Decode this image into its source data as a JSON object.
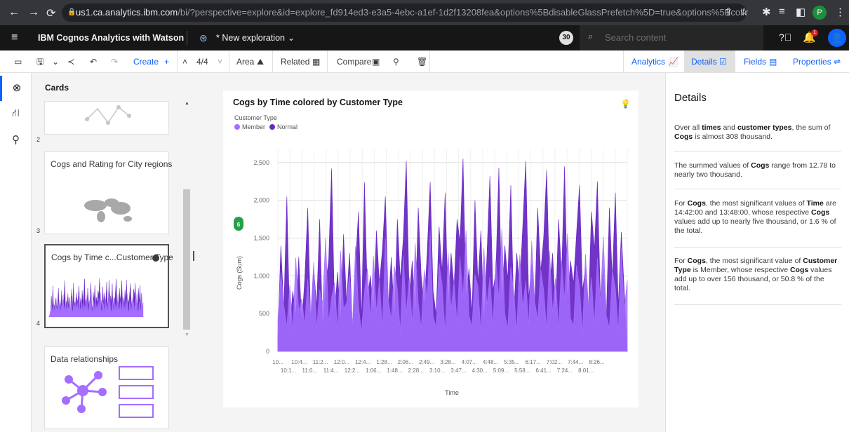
{
  "browser": {
    "url_host": "us1.ca.analytics.ibm.com",
    "url_rest": "/bi/?perspective=explore&id=explore_fd914ed3-e3a5-4ebc-a1ef-1d2f13208fea&options%5BdisableGlassPrefetch%5D=true&options%5Bcollections%5D%5Bcan...",
    "profile_initial": "P"
  },
  "app": {
    "title": "IBM Cognos Analytics with Watson",
    "exploration": "* New exploration",
    "badge_count": "30",
    "search_placeholder": "Search content",
    "notification_count": "1"
  },
  "toolbar": {
    "create": "Create",
    "create_plus": "+",
    "page_count": "4/4",
    "area": "Area",
    "related": "Related",
    "compare": "Compare",
    "analytics": "Analytics",
    "details": "Details",
    "fields": "Fields",
    "properties": "Properties"
  },
  "cards_panel": {
    "title": "Cards",
    "cards": [
      {
        "number": "2",
        "title": ""
      },
      {
        "number": "3",
        "title": "Cogs and Rating for City regions"
      },
      {
        "number": "4",
        "title": "Cogs by Time c...Customer Type"
      },
      {
        "number": "",
        "title": "Data relationships"
      }
    ]
  },
  "chart": {
    "legend_title": "Customer Type",
    "badge": "6"
  },
  "chart_data": {
    "type": "area",
    "title": "Cogs by Time colored by Customer Type",
    "xlabel": "Time",
    "ylabel": "Cogs (Sum)",
    "ylim": [
      0,
      2600
    ],
    "yticks": [
      "0",
      "500",
      "1,000",
      "1,500",
      "2,000",
      "2,500"
    ],
    "xticks_row1": [
      "10...",
      "10:4...",
      "11:2...",
      "12:0...",
      "12:4...",
      "1:28...",
      "2:06...",
      "2:49...",
      "3:28...",
      "4:07...",
      "4:48...",
      "5:35...",
      "6:17...",
      "7:02...",
      "7:44...",
      "8:26..."
    ],
    "xticks_row2": [
      "10:1...",
      "11:0...",
      "11:4...",
      "12:2...",
      "1:06...",
      "1:48...",
      "2:28...",
      "3:10...",
      "3:47...",
      "4:30...",
      "5:09...",
      "5:58...",
      "6:41...",
      "7:24...",
      "8:01..."
    ],
    "grid": true,
    "legend_position": "top-left",
    "series": [
      {
        "name": "Member",
        "color": "#a56eff",
        "values": [
          420,
          1050,
          610,
          330,
          880,
          260,
          1240,
          540,
          700,
          350,
          960,
          480,
          1180,
          300,
          820,
          640,
          1500,
          390,
          720,
          910,
          280,
          1330,
          570,
          640,
          1020,
          350,
          1390,
          600,
          260,
          790,
          1100,
          430,
          1260,
          520,
          950,
          310,
          1500,
          680,
          420,
          1130,
          830,
          260,
          1270,
          510,
          980,
          370,
          1430,
          640,
          310,
          1080,
          700,
          1600,
          460,
          320,
          1170,
          890,
          250,
          1310,
          560,
          940,
          380,
          1250,
          720,
          1600,
          470,
          330,
          1020,
          860,
          260,
          1370,
          610,
          990,
          340,
          1220,
          700,
          1620,
          500,
          300,
          1120,
          790,
          270,
          1280,
          580,
          930,
          350,
          1460,
          660,
          420,
          1090,
          820,
          290,
          1330,
          520,
          970,
          310,
          1200,
          690,
          1560,
          440,
          340,
          1140,
          860,
          250,
          1290,
          600,
          980,
          360,
          1240,
          660,
          1520,
          470,
          310,
          1070,
          840,
          270,
          1380,
          560,
          940
        ]
      },
      {
        "name": "Normal",
        "color": "#6929c4",
        "values": [
          200,
          1400,
          550,
          2050,
          300,
          800,
          450,
          1250,
          350,
          950,
          1900,
          400,
          1100,
          600,
          1750,
          300,
          900,
          1200,
          2420,
          500,
          1050,
          380,
          1550,
          650,
          1300,
          280,
          1150,
          1850,
          420,
          2240,
          700,
          1000,
          500,
          1600,
          900,
          1350,
          2050,
          600,
          1250,
          380,
          1750,
          950,
          1500,
          2520,
          700,
          1200,
          450,
          1900,
          1000,
          600,
          1300,
          2240,
          800,
          480,
          1650,
          1050,
          2100,
          550,
          1300,
          850,
          1750,
          1450,
          2550,
          700,
          1100,
          500,
          2000,
          900,
          1600,
          350,
          1250,
          2320,
          800,
          1050,
          2430,
          600,
          1400,
          950,
          2200,
          480,
          1300,
          850,
          1650,
          2520,
          700,
          1150,
          600,
          1900,
          1050,
          1500,
          2400,
          850,
          1300,
          520,
          1750,
          1000,
          2450,
          650,
          1200,
          900,
          1550,
          2200,
          800,
          1100,
          550,
          1850,
          1350,
          2250,
          700,
          1100,
          450,
          1900,
          950,
          2100,
          600,
          1580
        ]
      }
    ]
  },
  "details": {
    "title": "Details",
    "insights": [
      [
        {
          "t": "Over all "
        },
        {
          "t": "times",
          "b": true
        },
        {
          "t": " and "
        },
        {
          "t": "customer types",
          "b": true
        },
        {
          "t": ", the sum of "
        },
        {
          "t": "Cogs",
          "b": true
        },
        {
          "t": " is almost 308 thousand."
        }
      ],
      [
        {
          "t": "The summed values of "
        },
        {
          "t": "Cogs",
          "b": true
        },
        {
          "t": " range from 12.78 to nearly two thousand."
        }
      ],
      [
        {
          "t": "For "
        },
        {
          "t": "Cogs",
          "b": true
        },
        {
          "t": ", the most significant values of "
        },
        {
          "t": "Time",
          "b": true
        },
        {
          "t": " are 14:42:00 and 13:48:00, whose respective "
        },
        {
          "t": "Cogs",
          "b": true
        },
        {
          "t": " values add up to nearly five thousand, or 1.6 % of the total."
        }
      ],
      [
        {
          "t": "For "
        },
        {
          "t": "Cogs",
          "b": true
        },
        {
          "t": ", the most significant value of "
        },
        {
          "t": "Customer Type",
          "b": true
        },
        {
          "t": " is Member, whose respective "
        },
        {
          "t": "Cogs",
          "b": true
        },
        {
          "t": " values add up to over 156 thousand, or 50.8 % of the total."
        }
      ]
    ]
  },
  "icons": [
    "menu-icon",
    "catalog-icon",
    "lightbulb-icon",
    "pin-icon",
    "trash-icon",
    "help-icon",
    "bell-icon",
    "user-icon",
    "search-icon"
  ]
}
